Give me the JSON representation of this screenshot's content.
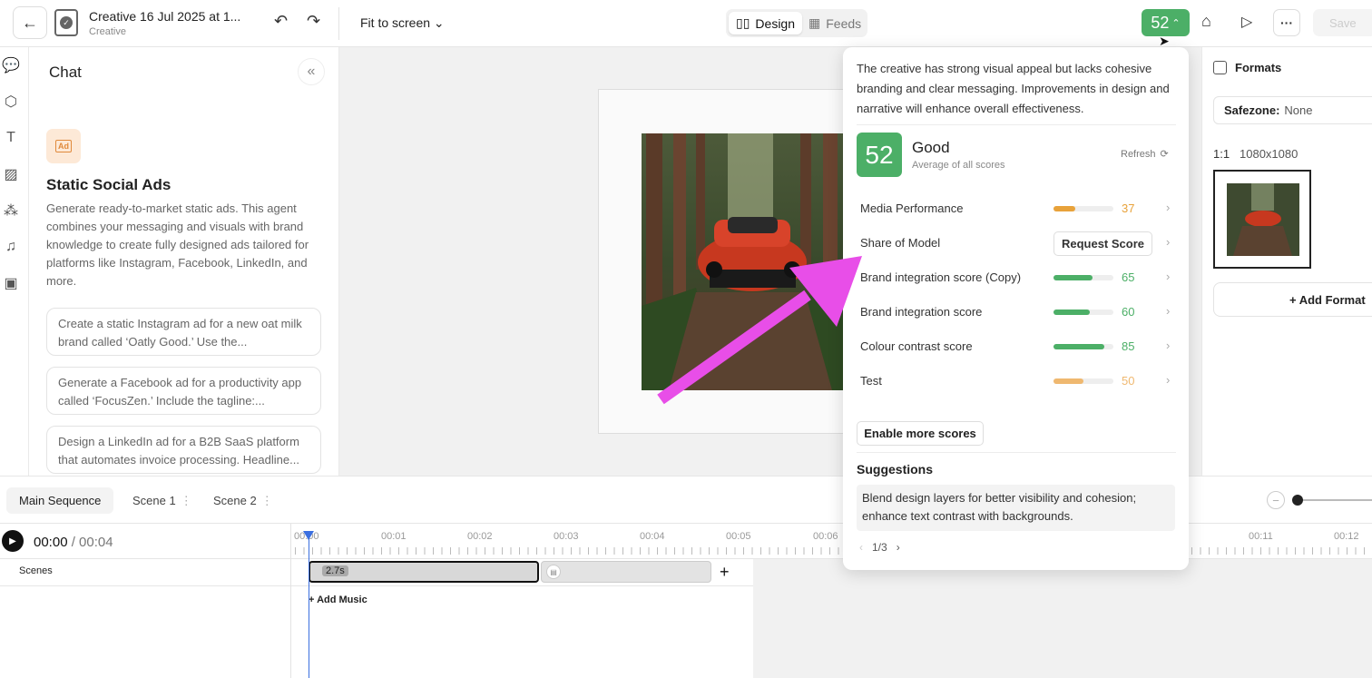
{
  "header": {
    "title": "Creative 16 Jul 2025 at 1...",
    "subtitle": "Creative",
    "fit_label": "Fit to screen",
    "tabs": [
      {
        "label": "Design",
        "active": true
      },
      {
        "label": "Feeds",
        "active": false
      }
    ],
    "score": "52",
    "save_label": "Save"
  },
  "chat": {
    "title": "Chat",
    "agent_icon_text": "Ad",
    "agent_title": "Static Social Ads",
    "agent_description": "Generate ready-to-market static ads. This agent combines your messaging and visuals with brand knowledge to create fully designed ads tailored for platforms like Instagram, Facebook, LinkedIn, and more.",
    "prompts": [
      "Create a static Instagram ad for a new oat milk brand called ‘Oatly Good.’ Use the...",
      "Generate a Facebook ad for a productivity app called ‘FocusZen.’ Include the tagline:...",
      "Design a LinkedIn ad for a B2B SaaS platform that automates invoice processing. Headline..."
    ]
  },
  "formats": {
    "title": "Formats",
    "safezone_label": "Safezone:",
    "safezone_value": "None",
    "ratio": "1:1",
    "dimensions": "1080x1080",
    "add_label": "+ Add Format"
  },
  "score_panel": {
    "summary": "The creative has strong visual appeal but lacks cohesive branding and clear messaging. Improvements in design and narrative will enhance overall effectiveness.",
    "score": "52",
    "rating": "Good",
    "rating_sub": "Average of all scores",
    "refresh_label": "Refresh",
    "metrics": [
      {
        "label": "Media Performance",
        "value": "37",
        "color": "#e8a23a"
      },
      {
        "label": "Share of Model",
        "action": "Request Score"
      },
      {
        "label": "Brand integration score (Copy)",
        "value": "65",
        "color": "#4caf67"
      },
      {
        "label": "Brand integration score",
        "value": "60",
        "color": "#4caf67"
      },
      {
        "label": "Colour contrast score",
        "value": "85",
        "color": "#4caf67"
      },
      {
        "label": "Test",
        "value": "50",
        "color": "#efb870"
      }
    ],
    "enable_label": "Enable more scores",
    "suggestions_title": "Suggestions",
    "suggestion": "Blend design layers for better visibility and cohesion; enhance text contrast with backgrounds.",
    "pager": "1/3"
  },
  "timeline": {
    "tabs": [
      "Main Sequence",
      "Scene 1",
      "Scene 2"
    ],
    "time_current": "00:00",
    "time_total": "/ 00:04",
    "ticks": [
      "00:00",
      "00:01",
      "00:02",
      "00:03",
      "00:04",
      "00:05",
      "00:06",
      "00:11",
      "00:12"
    ],
    "scenes_label": "Scenes",
    "clip_duration": "2.7s",
    "add_music": "+ Add Music"
  },
  "colors": {
    "score_green": "#4caf67",
    "annotation_arrow": "#e84ee8",
    "playhead": "#3b6fe0"
  }
}
